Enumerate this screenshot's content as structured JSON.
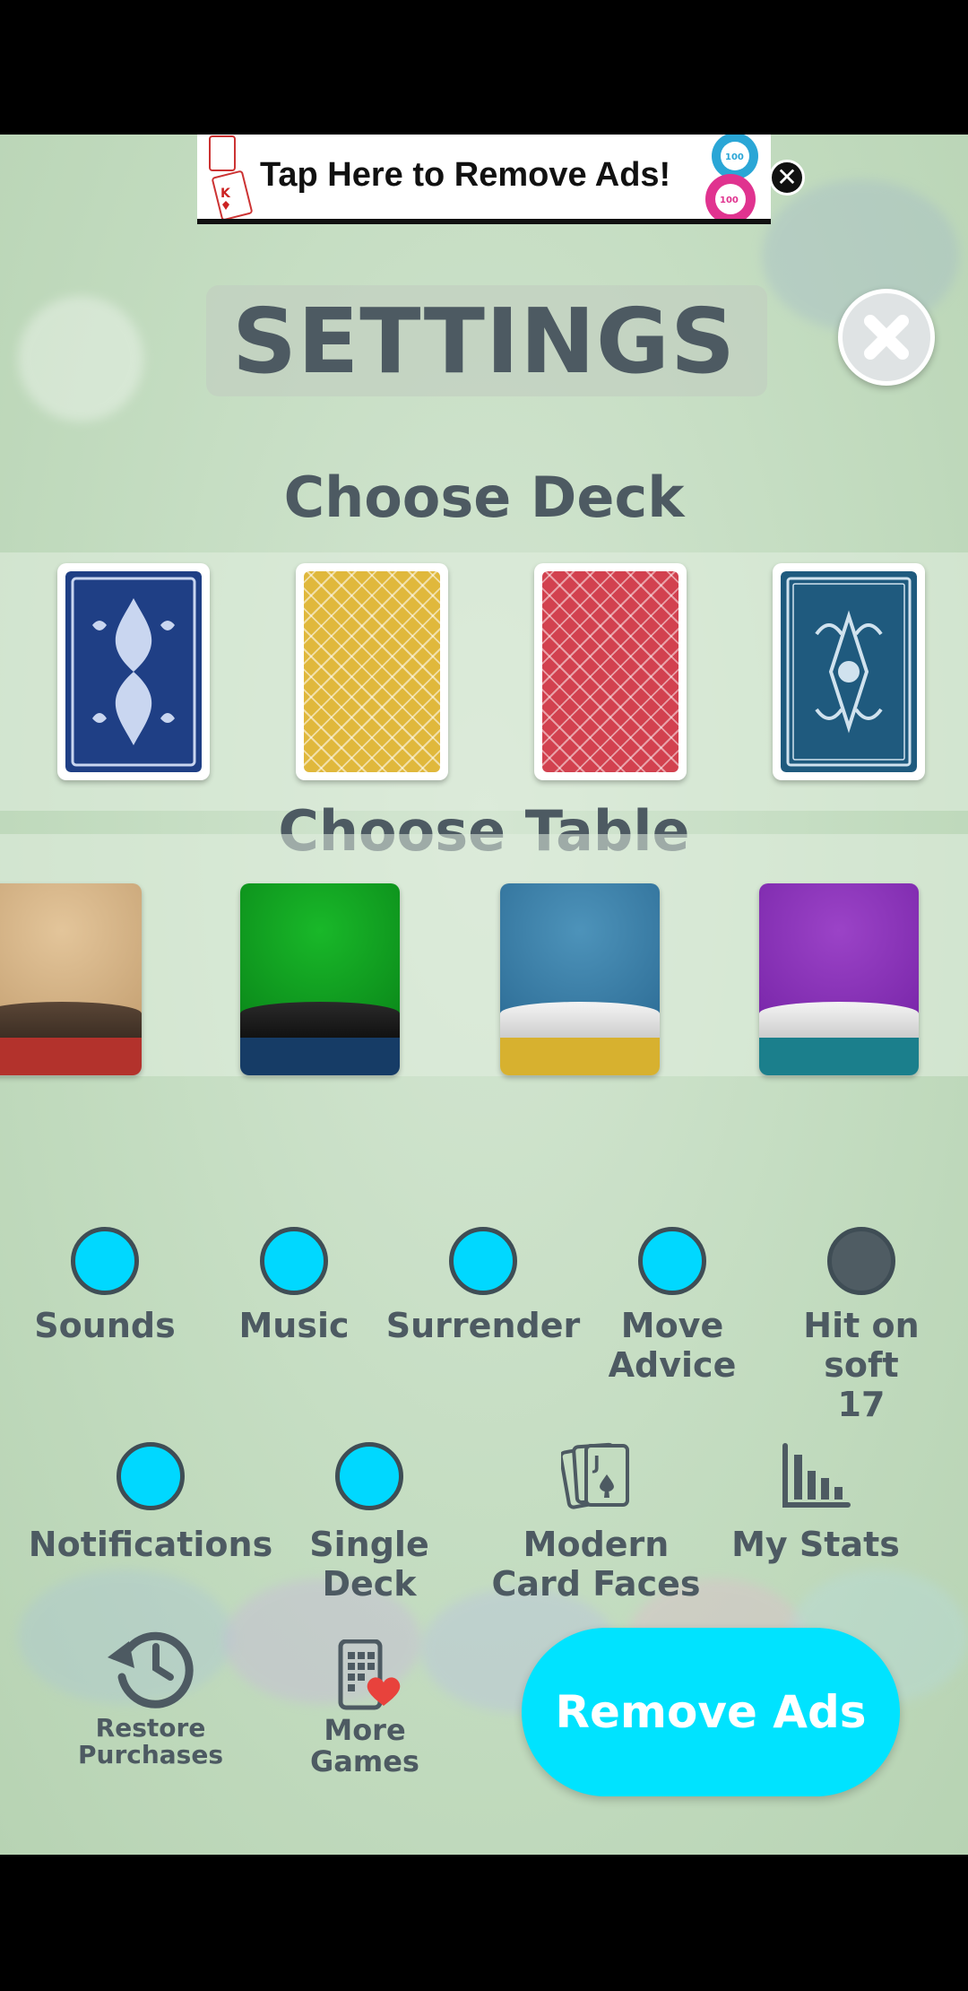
{
  "ad": {
    "text": "Tap Here to Remove Ads!",
    "close_icon": "close-icon"
  },
  "header": {
    "title": "SETTINGS"
  },
  "deck_section": {
    "heading": "Choose Deck",
    "decks": [
      "blue-ornate",
      "yellow-lattice",
      "red-lattice",
      "teal-ornate"
    ]
  },
  "table_section": {
    "heading": "Choose Table",
    "tables": [
      "tan",
      "green",
      "blue",
      "purple"
    ]
  },
  "toggles": {
    "sounds": {
      "label": "Sounds",
      "on": true
    },
    "music": {
      "label": "Music",
      "on": true
    },
    "surrender": {
      "label": "Surrender",
      "on": true
    },
    "move_advice": {
      "label_line1": "Move",
      "label_line2": "Advice",
      "on": true
    },
    "hit_soft": {
      "label_line1": "Hit on",
      "label_line2": "soft",
      "label_line3": "17",
      "on": false
    },
    "notifications": {
      "label": "Notifications",
      "on": true
    },
    "single_deck": {
      "label_line1": "Single",
      "label_line2": "Deck",
      "on": true
    }
  },
  "options": {
    "modern_faces": {
      "label_line1": "Modern",
      "label_line2": "Card Faces",
      "icon": "cards-icon"
    },
    "my_stats": {
      "label": "My Stats",
      "icon": "bar-chart-icon"
    }
  },
  "footer": {
    "restore": {
      "label_line1": "Restore",
      "label_line2": "Purchases",
      "icon": "history-icon"
    },
    "more_games": {
      "label_line1": "More",
      "label_line2": "Games",
      "icon": "phone-heart-icon"
    },
    "remove_ads": "Remove Ads"
  },
  "colors": {
    "toggle_on": "#00d8ff",
    "toggle_off": "#4f5c63",
    "text": "#4d5a62",
    "button": "#00e3ff"
  }
}
